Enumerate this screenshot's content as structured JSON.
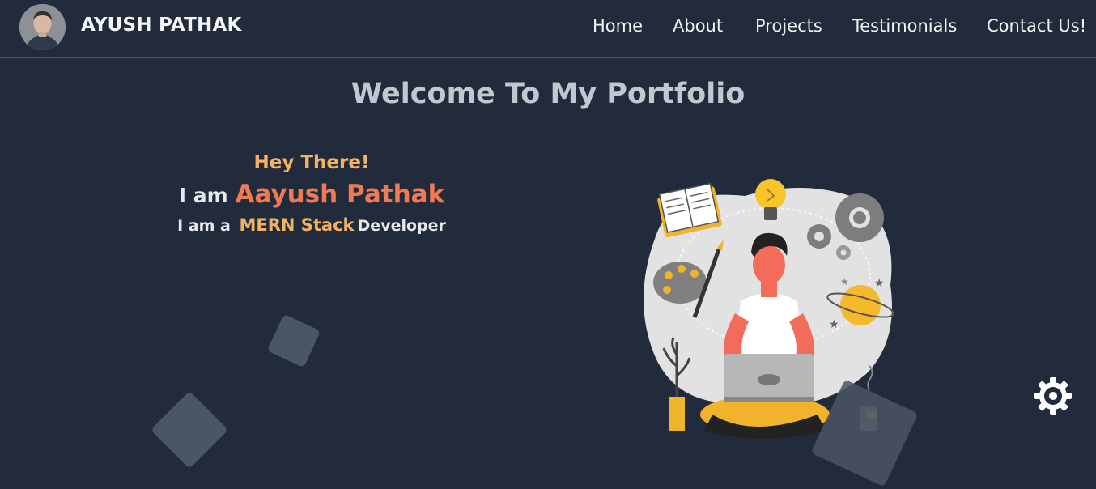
{
  "navbar": {
    "brand": "AYUSH PATHAK",
    "avatar_icon": "profile-photo",
    "links": [
      {
        "label": "Home"
      },
      {
        "label": "About"
      },
      {
        "label": "Projects"
      },
      {
        "label": "Testimonials"
      },
      {
        "label": "Contact Us!"
      }
    ]
  },
  "hero": {
    "welcome": "Welcome To My Portfolio",
    "greeting": "Hey There!",
    "name_prefix": "I am",
    "name": "Aayush Pathak",
    "role_prefix": "I am a",
    "role": "MERN Stack",
    "role_suffix": "Developer"
  },
  "icons": {
    "settings": "gear-icon",
    "moon": "moon-icon"
  },
  "colors": {
    "background": "#222b3b",
    "accent_orange": "#f07a54",
    "accent_yellow": "#f3b165",
    "heading_gray": "#c3c7cf"
  }
}
